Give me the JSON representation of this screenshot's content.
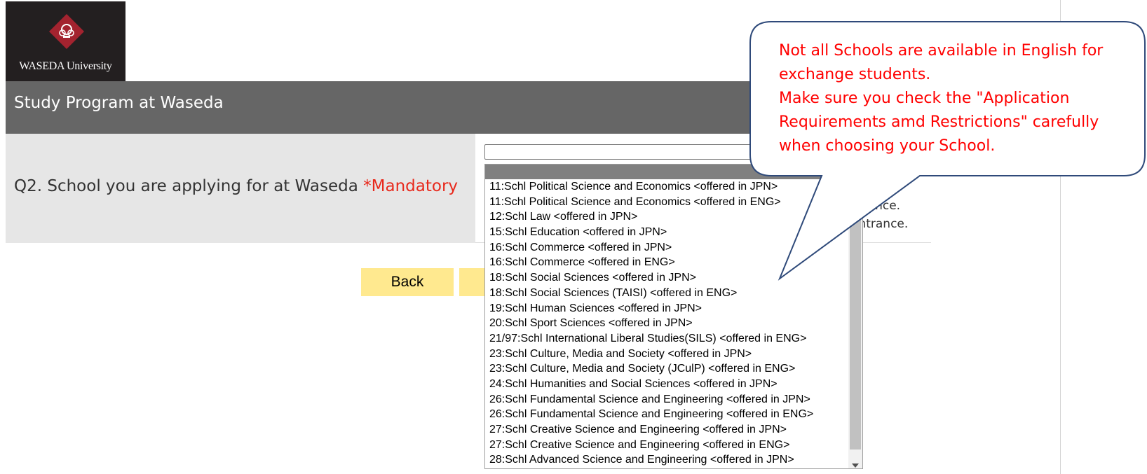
{
  "logo": {
    "text": "WASEDA University"
  },
  "page_title": "Study Program at Waseda",
  "question": {
    "label": "Q2. School you are applying for at Waseda",
    "mandatory": "*Mandatory"
  },
  "notes_behind": [
    "trance.",
    "entrance."
  ],
  "buttons": {
    "back": "Back",
    "next": ""
  },
  "dropdown": {
    "items": [
      "11:Schl Political Science and Economics <offered in JPN>",
      "11:Schl Political Science and Economics <offered in ENG>",
      "12:Schl Law <offered in JPN>",
      "15:Schl Education <offered in JPN>",
      "16:Schl Commerce <offered in JPN>",
      "16:Schl Commerce <offered in ENG>",
      "18:Schl Social Sciences <offered in JPN>",
      "18:Schl Social Sciences (TAISI) <offered in ENG>",
      "19:Schl Human Sciences <offered in JPN>",
      "20:Schl Sport Sciences <offered in JPN>",
      "21/97:Schl International Liberal Studies(SILS) <offered in ENG>",
      "23:Schl Culture, Media and Society <offered in JPN>",
      "23:Schl Culture, Media and Society (JCulP) <offered in ENG>",
      "24:Schl Humanities and Social Sciences <offered in JPN>",
      "26:Schl Fundamental Science and Engineering <offered in JPN>",
      "26:Schl Fundamental Science and Engineering <offered in ENG>",
      "27:Schl Creative Science and Engineering <offered in JPN>",
      "27:Schl Creative Science and Engineering <offered in ENG>",
      "28:Schl Advanced Science and Engineering <offered in JPN>"
    ]
  },
  "callout": {
    "lines": [
      "Not all Schools are available in English for",
      "exchange students.",
      "Make sure you check the \"Application",
      "Requirements amd Restrictions\" carefully",
      "when choosing your School."
    ]
  },
  "colors": {
    "title_bar": "#666666",
    "mandatory": "#e8291c",
    "button": "#ffe98f",
    "callout_text": "#ff0000",
    "callout_border": "#2f4a7a",
    "logo_red": "#a3232f"
  }
}
